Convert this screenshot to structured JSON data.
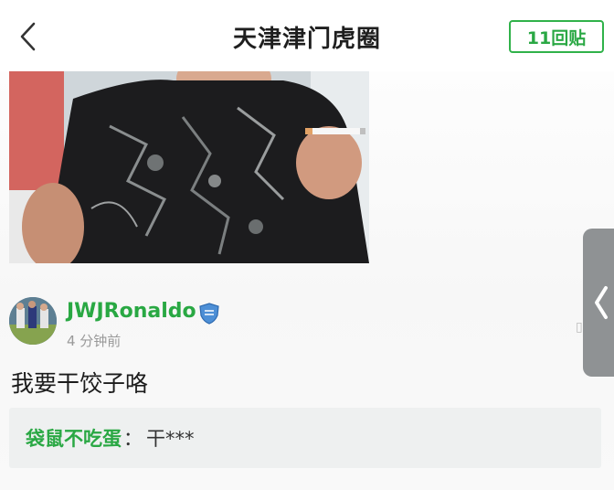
{
  "header": {
    "title": "天津津门虎圈",
    "reply_count_label": "11回贴"
  },
  "icons": {
    "back": "chevron-left-icon",
    "side_tab": "chevron-left-icon",
    "user_badge": "shield-badge-icon"
  },
  "comment": {
    "username": "JWJRonaldo",
    "time": "4 分钟前",
    "text": "我要干饺子咯",
    "reply": {
      "user": "袋鼠不吃蛋",
      "separator": "：",
      "content": "干***"
    }
  },
  "colors": {
    "accent_green": "#2aa844",
    "side_tab_gray": "#8f9294",
    "reply_bg": "#eef0f0"
  }
}
